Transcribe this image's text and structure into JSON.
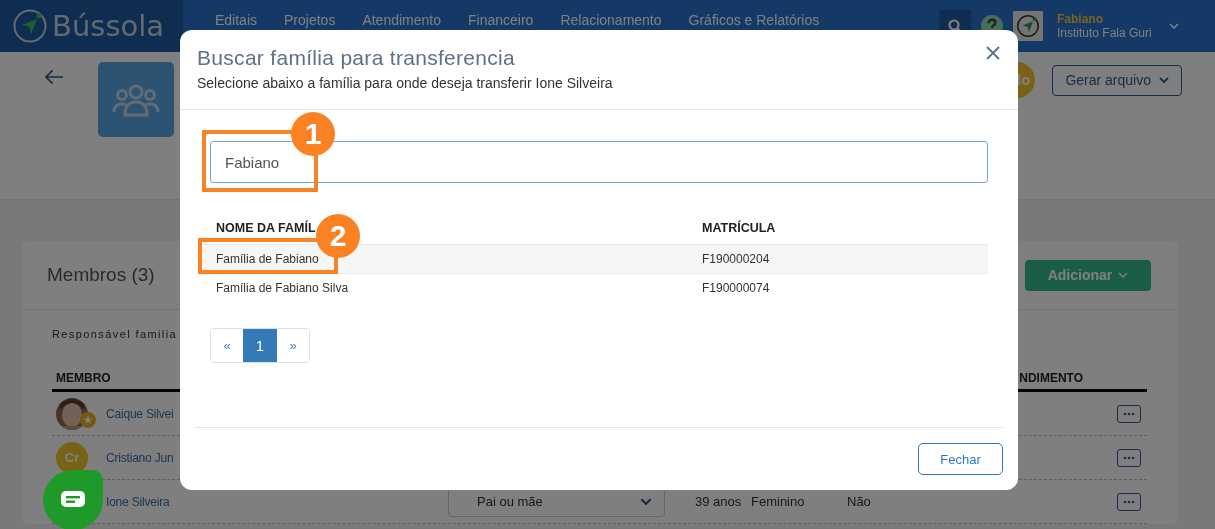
{
  "nav": {
    "brand": "Bússola",
    "items": [
      {
        "label": "Editais"
      },
      {
        "label": "Projetos"
      },
      {
        "label": "Atendimento"
      },
      {
        "label": "Financeiro"
      },
      {
        "label": "Relacionamento"
      },
      {
        "label": "Gráficos e Relatórios"
      }
    ],
    "user": {
      "name": "Fabiano",
      "organization": "Instituto Fala Guri"
    }
  },
  "header": {
    "status_badge": "lo",
    "export_button": "Gerar arquivo"
  },
  "members_card": {
    "title": "Membros (3)",
    "add_button": "Adicionar",
    "responsible_label": "Responsável familia",
    "columns": [
      "MEMBRO",
      "NDIMENTO"
    ],
    "rows": [
      {
        "starred": true,
        "name": "Caique Silvei"
      },
      {
        "kind": "initials",
        "initials": "Cr",
        "starred": false,
        "name": "Cristiano Jun"
      },
      {
        "starred": false,
        "name": "Ione Silveira",
        "relationship": "Pai ou mãe",
        "age": "39 anos",
        "gender": "Feminino",
        "column_6": "Não"
      }
    ]
  },
  "modal": {
    "title": "Buscar família para transferencia",
    "subtitle": "Selecione abaixo a família para onde deseja transferir Ione Silveira",
    "search_value": "Fabiano",
    "columns": [
      "NOME DA FAMÍL",
      "MATRÍCULA"
    ],
    "rows": [
      {
        "name": "Família de Fabiano",
        "registration": "F190000204",
        "highlighted": true
      },
      {
        "name": "Família de Fabiano Silva",
        "registration": "F190000074",
        "highlighted": false
      }
    ],
    "pagination": [
      {
        "label": "«",
        "selected": false
      },
      {
        "label": "1",
        "selected": true
      },
      {
        "label": "»",
        "selected": false
      }
    ],
    "close_button": "Fechar"
  },
  "annotations": [
    {
      "label": "1"
    },
    {
      "label": "2"
    }
  ]
}
